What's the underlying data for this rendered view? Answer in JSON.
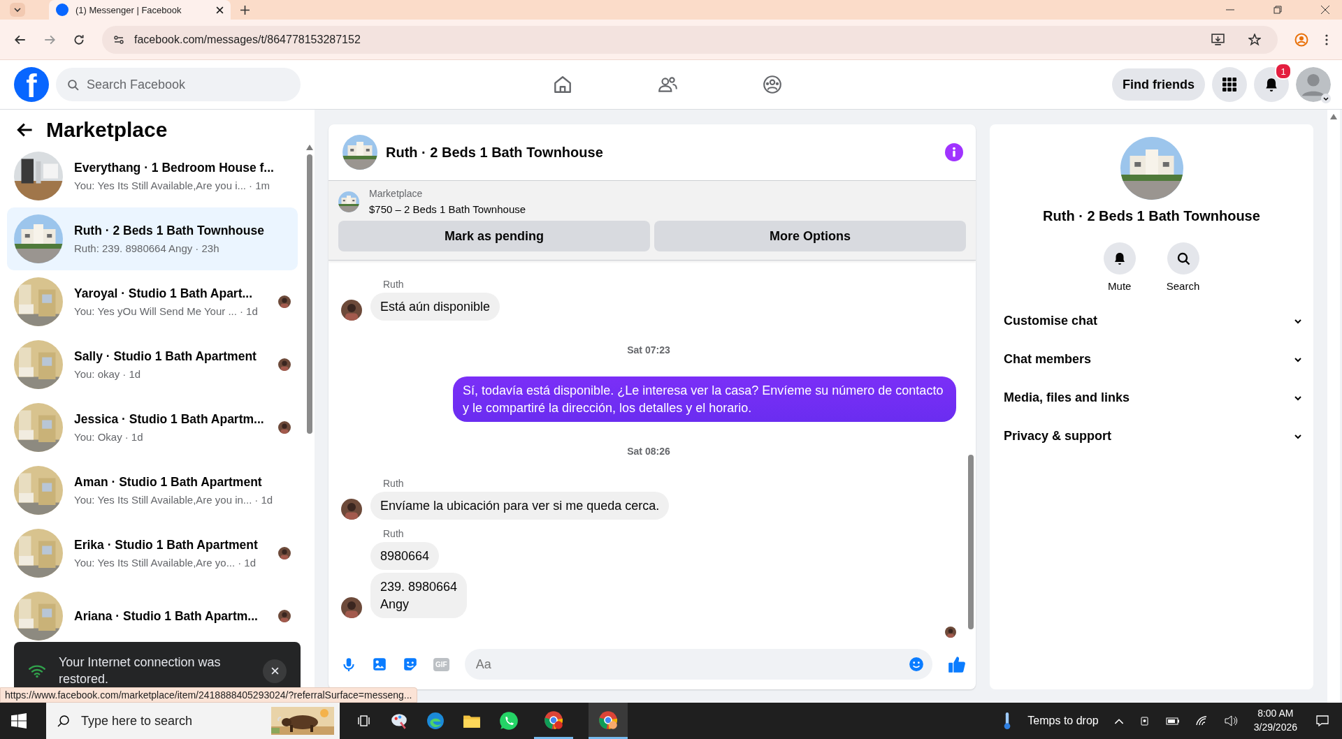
{
  "browser": {
    "tab_title": "(1) Messenger | Facebook",
    "url": "facebook.com/messages/t/864778153287152"
  },
  "header": {
    "logo": "f",
    "search_placeholder": "Search Facebook",
    "find_friends": "Find friends",
    "notification_count": "1"
  },
  "sidebar": {
    "title": "Marketplace",
    "conversations": [
      {
        "title": "Everythang · 1 Bedroom House f...",
        "preview": "You: Yes Its Still Available,Are you i...",
        "time": "· 1m",
        "selected": false,
        "seen": false
      },
      {
        "title": "Ruth · 2 Beds 1 Bath Townhouse",
        "preview": "Ruth: 239. 8980664 Angy",
        "time": "· 23h",
        "selected": true,
        "seen": false
      },
      {
        "title": "Yaroyal · Studio 1 Bath Apart...",
        "preview": "You: Yes yOu Will Send Me Your ...",
        "time": "· 1d",
        "selected": false,
        "seen": true
      },
      {
        "title": "Sally · Studio 1 Bath Apartment",
        "preview": "You: okay",
        "time": "· 1d",
        "selected": false,
        "seen": true
      },
      {
        "title": "Jessica · Studio 1 Bath Apartm...",
        "preview": "You: Okay",
        "time": "· 1d",
        "selected": false,
        "seen": true
      },
      {
        "title": "Aman · Studio 1 Bath Apartment",
        "preview": "You: Yes Its Still Available,Are you in...",
        "time": "· 1d",
        "selected": false,
        "seen": false
      },
      {
        "title": "Erika · Studio 1 Bath Apartment",
        "preview": "You: Yes Its Still Available,Are yo...",
        "time": "· 1d",
        "selected": false,
        "seen": true
      },
      {
        "title": "Ariana · Studio 1 Bath Apartm...",
        "selected": false,
        "seen": true
      }
    ]
  },
  "toast": {
    "text": "Your Internet connection was restored."
  },
  "chat": {
    "title": "Ruth · 2 Beds 1 Bath Townhouse",
    "listing": {
      "label": "Marketplace",
      "title": "$750 – 2 Beds 1 Bath Townhouse"
    },
    "actions": [
      "Mark as pending",
      "More Options"
    ],
    "messages": [
      {
        "kind": "incoming",
        "sender": "Ruth",
        "bubbles": [
          "Está aún disponible"
        ]
      },
      {
        "kind": "timestamp",
        "text": "Sat 07:23"
      },
      {
        "kind": "outgoing",
        "bubbles": [
          "Sí, todavía está disponible. ¿Le interesa ver la casa? Envíeme su número de contacto y le compartiré la dirección, los detalles y el horario."
        ]
      },
      {
        "kind": "timestamp",
        "text": "Sat 08:26"
      },
      {
        "kind": "incoming",
        "sender": "Ruth",
        "bubbles": [
          "Envíame la ubicación para ver si me queda cerca."
        ]
      },
      {
        "kind": "incoming",
        "sender": "Ruth",
        "bubbles": [
          "8980664",
          "239.  8980664\nAngy"
        ]
      }
    ],
    "gif_label": "GIF",
    "composer_placeholder": "Aa"
  },
  "details": {
    "title": "Ruth · 2 Beds 1 Bath Townhouse",
    "actions": [
      "Mute",
      "Search"
    ],
    "sections": [
      "Customise chat",
      "Chat members",
      "Media, files and links",
      "Privacy & support"
    ]
  },
  "status_url": "https://www.facebook.com/marketplace/item/2418888405293024/?referralSurface=messeng...",
  "taskbar": {
    "search_placeholder": "Type here to search",
    "weather": "Temps to drop",
    "time": "8:00 AM",
    "date": "3/29/2026"
  }
}
